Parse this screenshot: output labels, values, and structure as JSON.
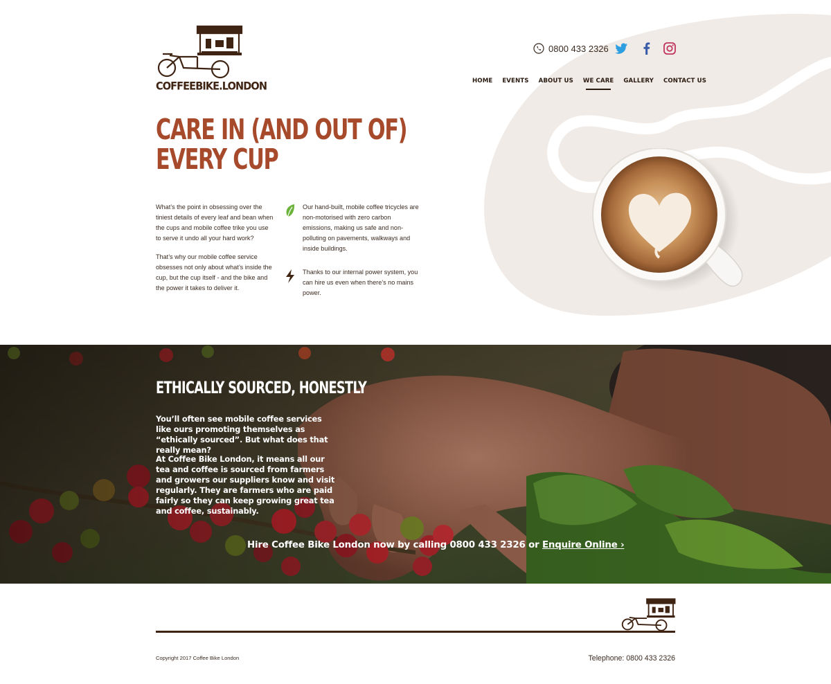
{
  "brand": {
    "name": "COFFEEBIKE.LONDON"
  },
  "header": {
    "phone": "0800 433 2326",
    "social": [
      "twitter-icon",
      "facebook-icon",
      "instagram-icon"
    ],
    "nav": [
      {
        "label": "HOME",
        "active": false
      },
      {
        "label": "EVENTS",
        "active": false
      },
      {
        "label": "ABOUT US",
        "active": false
      },
      {
        "label": "WE CARE",
        "active": true
      },
      {
        "label": "GALLERY",
        "active": false
      },
      {
        "label": "CONTACT US",
        "active": false
      }
    ]
  },
  "hero": {
    "title_line1": "CARE IN (AND OUT OF)",
    "title_line2": "EVERY CUP",
    "intro_paragraphs": [
      "What’s the point in obsessing over the tiniest details of every leaf and bean when the cups and mobile coffee trike you use to serve it undo all your hard work?",
      "That’s why our mobile coffee service obsesses not only about what’s inside the cup, but the cup itself - and the bike and the power it takes to deliver it."
    ],
    "features": [
      {
        "icon": "leaf-icon",
        "text": "Our hand-built, mobile coffee tricycles are non-motorised with zero carbon emissions, making us safe and non-polluting on pavements, walkways and inside buildings."
      },
      {
        "icon": "lightning-icon",
        "text": "Thanks to our internal power system, you can hire us even when there’s no mains power."
      }
    ]
  },
  "ethics": {
    "title": "ETHICALLY SOURCED, HONESTLY",
    "paragraphs": [
      "You’ll often see mobile coffee services like ours promoting themselves as “ethically sourced”. But what does that really mean?",
      "At Coffee Bike London, it means all our tea and coffee is sourced from farmers and growers our suppliers know and visit regularly. They are farmers who are paid fairly so they can keep growing great tea and coffee, sustainably."
    ],
    "cta_text": "Hire Coffee Bike London now by calling 0800 433 2326 or ",
    "cta_link": "Enquire Online ›"
  },
  "footer": {
    "copyright": "Copyright 2017 Coffee Bike London",
    "telephone": "Telephone: 0800 433 2326"
  },
  "colors": {
    "accent": "#a64a2b",
    "brand_dark": "#3f2414",
    "blob": "#f0ebe7",
    "leaf": "#6bb33a"
  }
}
